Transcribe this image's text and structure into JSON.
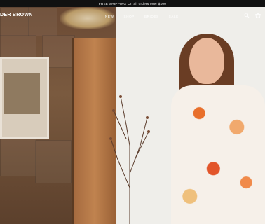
{
  "announcement": {
    "prefix": "FREE SHIPPING",
    "link": "On all orders over $100"
  },
  "header": {
    "logo": "DER BROWN",
    "nav": [
      "NEW",
      "SHOP",
      "BRIDES",
      "SALE"
    ],
    "icons": [
      "search-icon",
      "cart-icon"
    ]
  }
}
